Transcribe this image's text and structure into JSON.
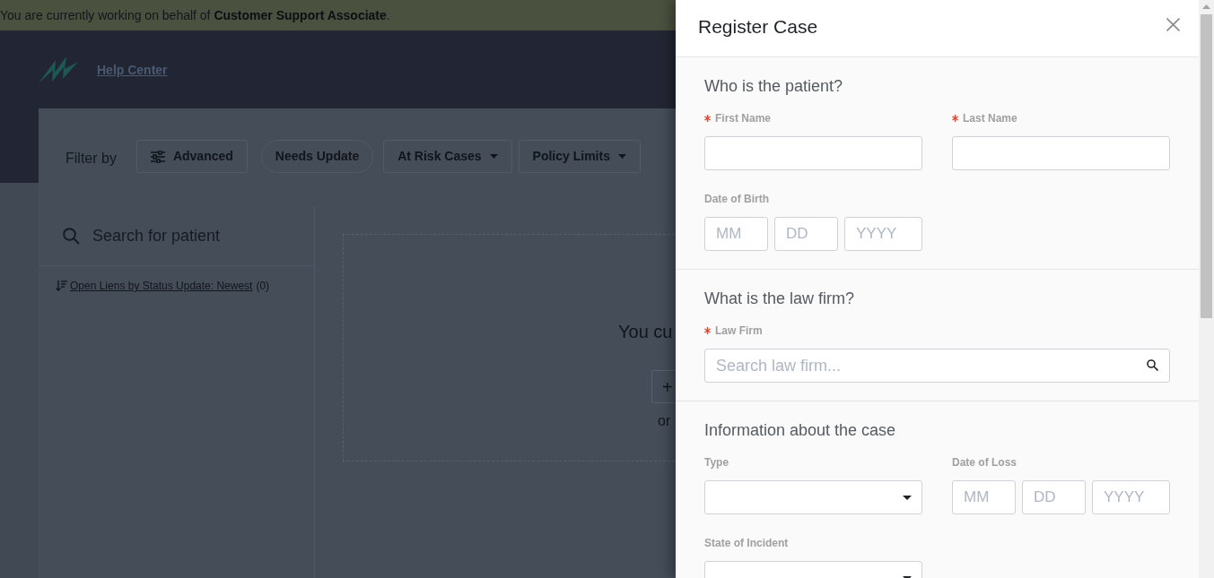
{
  "banner": {
    "text": "You are currently working on behalf of **Customer Support Associate**."
  },
  "header": {
    "link": "Help Center"
  },
  "filter_bar": {
    "label": "Filter by",
    "filters": [
      {
        "kind": "advanced",
        "label": "Advanced"
      },
      {
        "kind": "pill",
        "label": "Needs Update"
      },
      {
        "kind": "dropdown",
        "label": "At Risk Cases"
      },
      {
        "kind": "dropdown",
        "label": "Policy Limits"
      }
    ]
  },
  "patient_list": {
    "search": {
      "placeholder": "Search for patient"
    },
    "sort_link": "Open Liens by Status Update: Newest",
    "count": "(0)"
  },
  "empty_state": {
    "message": "You cu",
    "button": "+",
    "note": "or"
  },
  "drawer": {
    "title": "Register Case",
    "sections": [
      {
        "heading": "Who is the patient?",
        "fields": [
          {
            "kind": "text",
            "label": "First Name",
            "required": true
          },
          {
            "kind": "text",
            "label": "Last Name",
            "required": true
          },
          {
            "kind": "date",
            "label": "Date of Birth",
            "required": false,
            "parts": [
              {
                "placeholder": "MM"
              },
              {
                "placeholder": "DD"
              },
              {
                "placeholder": "YYYY"
              }
            ]
          }
        ]
      },
      {
        "heading": "What is the law firm?",
        "fields": [
          {
            "kind": "search",
            "label": "Law Firm",
            "required": true,
            "placeholder": "Search law firm..."
          }
        ]
      },
      {
        "heading": "Information about the case",
        "fields": [
          {
            "kind": "select",
            "label": "Type",
            "required": false
          },
          {
            "kind": "date",
            "label": "Date of Loss",
            "required": false,
            "parts": [
              {
                "placeholder": "MM"
              },
              {
                "placeholder": "DD"
              },
              {
                "placeholder": "YYYY"
              }
            ]
          },
          {
            "kind": "select",
            "label": "State of Incident",
            "required": false
          }
        ]
      }
    ]
  }
}
